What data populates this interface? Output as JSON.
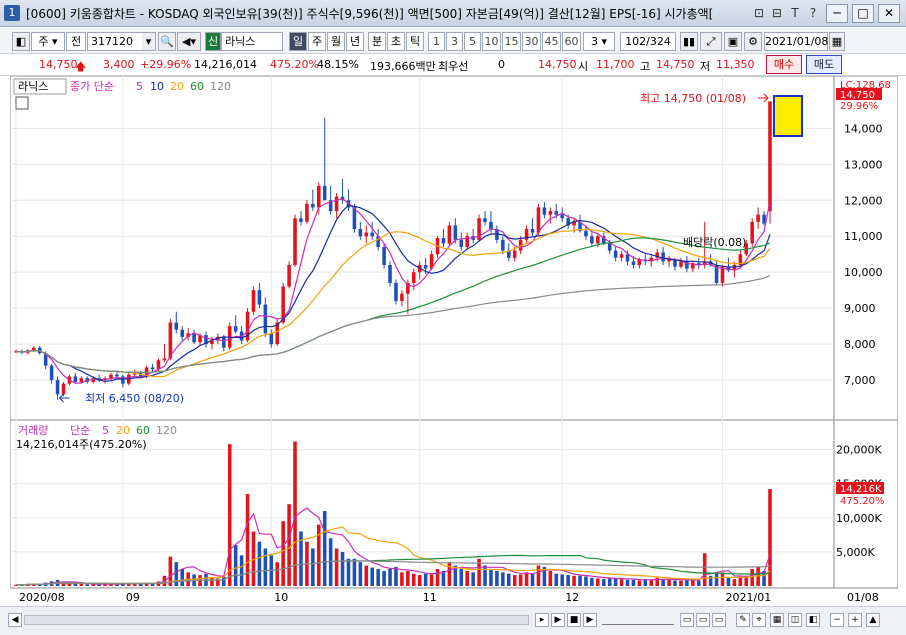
{
  "window": {
    "icon_label": "1",
    "title": "[0600] 키움종합차트 - KOSDAQ 외국인보유[39(천)] 주식수[9,596(천)] 액면[500] 자본금[49(억)] 결산[12월] EPS[-16] 시가총액[",
    "tools": [
      "⊡",
      "⊟",
      "T",
      "?"
    ],
    "minimize": "─",
    "maximize": "□",
    "close": "✕"
  },
  "toolbar": {
    "period_label": "주",
    "prev_label": "전",
    "code": "317120",
    "stock_badge": "신",
    "stock_name": "라닉스",
    "period_tabs": [
      "일",
      "주",
      "월",
      "년",
      "분",
      "초",
      "틱"
    ],
    "minute_options": [
      "1",
      "3",
      "5",
      "10",
      "15",
      "30",
      "45",
      "60"
    ],
    "minute_select": "3",
    "page_count": "102/324",
    "date": "2021/01/08"
  },
  "quote": {
    "price": "14,750",
    "change": "3,400",
    "change_pct": "+29.96%",
    "volume": "14,216,014",
    "vol_ratio": "475.20%",
    "turnover": "48.15%",
    "amount": "193,666백만",
    "priority_label": "최우선",
    "priority_value": "0",
    "last": "14,750",
    "open_label": "시",
    "open": "11,700",
    "high_label": "고",
    "high": "14,750",
    "low_label": "저",
    "low": "11,350",
    "buy_label": "매수",
    "sell_label": "매도"
  },
  "colors": {
    "up": "#e3121b",
    "down": "#1f4fb8",
    "ma5": "#c82fb6",
    "ma10": "#1a2a9e",
    "ma20": "#f0a30a",
    "ma60": "#1f8f3a",
    "ma120": "#8a8a8a"
  },
  "price_panel": {
    "legend_name": "라닉스",
    "legend_type": "종가 단순",
    "ma_periods": [
      "5",
      "10",
      "20",
      "60",
      "120"
    ],
    "right_top_label": "LC:128.68",
    "current_price_tag": "14,750",
    "current_pct_tag": "29.96%",
    "high_annotation": "최고 14,750 (01/08)",
    "low_annotation": "최저 6,450 (08/20)",
    "event_annotation": "배당락(0.08)",
    "y_ticks": [
      "14,000",
      "13,000",
      "12,000",
      "11,000",
      "10,000",
      "9,000",
      "8,000",
      "7,000"
    ]
  },
  "volume_panel": {
    "legend_name": "거래량",
    "legend_type": "단순",
    "ma_periods": [
      "5",
      "20",
      "60",
      "120"
    ],
    "current_value_label": "14,216,014주(475.20%)",
    "current_tag": "14,216K",
    "current_pct_tag": "475.20%",
    "y_ticks": [
      "20,000K",
      "15,000K",
      "10,000K",
      "5,000K"
    ]
  },
  "x_axis": {
    "labels": [
      "2020/08",
      "09",
      "10",
      "11",
      "12",
      "2021/01",
      "01/08"
    ]
  },
  "chart_data": {
    "type": "candlestick",
    "price_range": [
      6000,
      14900
    ],
    "volume_range": [
      0,
      22000
    ],
    "candles": [
      [
        7800,
        7850,
        7750,
        7800,
        180
      ],
      [
        7800,
        7850,
        7720,
        7760,
        200
      ],
      [
        7760,
        7860,
        7700,
        7830,
        260
      ],
      [
        7830,
        7950,
        7780,
        7900,
        300
      ],
      [
        7900,
        7950,
        7700,
        7750,
        350
      ],
      [
        7750,
        7800,
        7300,
        7400,
        500
      ],
      [
        7400,
        7450,
        6900,
        7000,
        700
      ],
      [
        7000,
        7100,
        6450,
        6600,
        900
      ],
      [
        6600,
        6950,
        6550,
        6900,
        500
      ],
      [
        6900,
        7150,
        6850,
        7100,
        450
      ],
      [
        7100,
        7200,
        6900,
        6950,
        350
      ],
      [
        6950,
        7100,
        6900,
        7050,
        300
      ],
      [
        7050,
        7100,
        6900,
        6950,
        260
      ],
      [
        6950,
        7100,
        6900,
        7050,
        280
      ],
      [
        7050,
        7150,
        6950,
        7000,
        250
      ],
      [
        7000,
        7100,
        6900,
        7050,
        260
      ],
      [
        7050,
        7200,
        7000,
        7150,
        300
      ],
      [
        7150,
        7250,
        7050,
        7100,
        280
      ],
      [
        7100,
        7150,
        6800,
        6900,
        350
      ],
      [
        6900,
        7200,
        6850,
        7150,
        420
      ],
      [
        7150,
        7300,
        7100,
        7200,
        380
      ],
      [
        7200,
        7250,
        7050,
        7100,
        300
      ],
      [
        7100,
        7400,
        7050,
        7350,
        450
      ],
      [
        7350,
        7450,
        7200,
        7300,
        350
      ],
      [
        7300,
        7600,
        7250,
        7550,
        650
      ],
      [
        7550,
        8000,
        7500,
        7600,
        1500
      ],
      [
        7600,
        8700,
        7550,
        8600,
        4300
      ],
      [
        8600,
        8900,
        8300,
        8400,
        3500
      ],
      [
        8400,
        8500,
        8100,
        8200,
        2500
      ],
      [
        8200,
        8450,
        8100,
        8300,
        2000
      ],
      [
        8300,
        8400,
        8000,
        8050,
        1700
      ],
      [
        8050,
        8300,
        7950,
        8250,
        1600
      ],
      [
        8250,
        8350,
        7900,
        8000,
        1800
      ],
      [
        8000,
        8200,
        7850,
        8100,
        1300
      ],
      [
        8100,
        8300,
        8000,
        8200,
        1100
      ],
      [
        8200,
        8250,
        7800,
        7900,
        1400
      ],
      [
        7900,
        8600,
        7850,
        8500,
        20800
      ],
      [
        8500,
        8800,
        8300,
        8350,
        6000
      ],
      [
        8350,
        8500,
        8000,
        8100,
        4500
      ],
      [
        8100,
        9000,
        8050,
        8900,
        13500
      ],
      [
        8900,
        9600,
        8800,
        9500,
        8000
      ],
      [
        9500,
        9700,
        9000,
        9100,
        6500
      ],
      [
        9100,
        9300,
        8200,
        8300,
        5500
      ],
      [
        8300,
        8400,
        7900,
        8000,
        4500
      ],
      [
        8000,
        8700,
        7950,
        8600,
        3500
      ],
      [
        8600,
        9700,
        8550,
        9600,
        9500
      ],
      [
        9600,
        10300,
        9550,
        10200,
        12000
      ],
      [
        10200,
        11600,
        10150,
        11500,
        21200
      ],
      [
        11500,
        11700,
        11300,
        11400,
        8000
      ],
      [
        11400,
        12000,
        11350,
        11900,
        6500
      ],
      [
        11900,
        12300,
        11700,
        11800,
        5500
      ],
      [
        11800,
        12500,
        11600,
        12400,
        9000
      ],
      [
        12400,
        14300,
        12000,
        12000,
        11000
      ],
      [
        12000,
        12400,
        11600,
        11700,
        7000
      ],
      [
        11700,
        12200,
        11500,
        12100,
        5500
      ],
      [
        12100,
        12600,
        11900,
        12000,
        5000
      ],
      [
        12000,
        12300,
        11700,
        11800,
        4000
      ],
      [
        11800,
        11900,
        11100,
        11200,
        4000
      ],
      [
        11200,
        11400,
        10900,
        11000,
        3500
      ],
      [
        11000,
        11300,
        10800,
        11100,
        3000
      ],
      [
        11100,
        11400,
        10900,
        11000,
        2700
      ],
      [
        11000,
        11200,
        10600,
        10700,
        2500
      ],
      [
        10700,
        10800,
        10100,
        10200,
        2200
      ],
      [
        10200,
        10300,
        9600,
        9700,
        2500
      ],
      [
        9700,
        9800,
        9100,
        9200,
        2800
      ],
      [
        9200,
        9500,
        9050,
        9400,
        2000
      ],
      [
        9400,
        9800,
        8850,
        9700,
        2200
      ],
      [
        9700,
        10100,
        9500,
        10000,
        1800
      ],
      [
        10000,
        10300,
        9800,
        10200,
        1600
      ],
      [
        10200,
        10400,
        9950,
        10100,
        1800
      ],
      [
        10100,
        10600,
        10050,
        10500,
        1700
      ],
      [
        10500,
        11000,
        10400,
        10950,
        2500
      ],
      [
        10950,
        11200,
        10700,
        10800,
        2200
      ],
      [
        10800,
        11400,
        10750,
        11300,
        3500
      ],
      [
        11300,
        11500,
        10800,
        10900,
        3000
      ],
      [
        10900,
        11100,
        10600,
        10700,
        2500
      ],
      [
        10700,
        11100,
        10650,
        11000,
        2200
      ],
      [
        11000,
        11200,
        10800,
        10900,
        2000
      ],
      [
        10900,
        11600,
        10850,
        11500,
        4000
      ],
      [
        11500,
        11700,
        11300,
        11400,
        3000
      ],
      [
        11400,
        11700,
        11100,
        11200,
        2500
      ],
      [
        11200,
        11300,
        10800,
        10900,
        2200
      ],
      [
        10900,
        11000,
        10500,
        10600,
        2000
      ],
      [
        10600,
        10800,
        10300,
        10400,
        1800
      ],
      [
        10400,
        10700,
        10300,
        10600,
        1600
      ],
      [
        10600,
        11000,
        10500,
        10900,
        1700
      ],
      [
        10900,
        11300,
        10800,
        11200,
        2000
      ],
      [
        11200,
        11500,
        11000,
        11100,
        1900
      ],
      [
        11100,
        11900,
        11000,
        11800,
        3000
      ],
      [
        11800,
        11950,
        11500,
        11600,
        2800
      ],
      [
        11600,
        11800,
        11350,
        11700,
        2200
      ],
      [
        11700,
        11900,
        11500,
        11600,
        1800
      ],
      [
        11600,
        11800,
        11400,
        11500,
        1700
      ],
      [
        11500,
        11600,
        11200,
        11300,
        1600
      ],
      [
        11300,
        11500,
        11100,
        11400,
        1500
      ],
      [
        11400,
        11600,
        11100,
        11150,
        1500
      ],
      [
        11150,
        11300,
        10900,
        11000,
        1400
      ],
      [
        11000,
        11100,
        10700,
        10800,
        1200
      ],
      [
        10800,
        11050,
        10700,
        11000,
        1100
      ],
      [
        11000,
        11100,
        10750,
        10800,
        1000
      ],
      [
        10800,
        10900,
        10500,
        10600,
        1200
      ],
      [
        10600,
        10700,
        10300,
        10400,
        1100
      ],
      [
        10400,
        10600,
        10300,
        10500,
        1000
      ],
      [
        10500,
        10600,
        10200,
        10300,
        900
      ],
      [
        10300,
        10450,
        10100,
        10200,
        900
      ],
      [
        10200,
        10400,
        10100,
        10350,
        800
      ],
      [
        10350,
        10500,
        10200,
        10300,
        1000
      ],
      [
        10300,
        10500,
        10150,
        10400,
        900
      ],
      [
        10400,
        10650,
        10300,
        10550,
        1200
      ],
      [
        10550,
        10700,
        10200,
        10300,
        1000
      ],
      [
        10300,
        10450,
        10150,
        10350,
        900
      ],
      [
        10350,
        10400,
        10050,
        10150,
        800
      ],
      [
        10150,
        10400,
        10100,
        10300,
        800
      ],
      [
        10300,
        10450,
        10000,
        10100,
        1000
      ],
      [
        10100,
        10300,
        10000,
        10250,
        900
      ],
      [
        10250,
        10400,
        10100,
        10200,
        800
      ],
      [
        10200,
        11400,
        10100,
        10300,
        4800
      ],
      [
        10300,
        10500,
        10150,
        10200,
        1500
      ],
      [
        10200,
        10300,
        9650,
        9700,
        1800
      ],
      [
        9700,
        10200,
        9600,
        10150,
        2000
      ],
      [
        10150,
        10400,
        10000,
        10050,
        1200
      ],
      [
        10050,
        10300,
        9850,
        10200,
        1000
      ],
      [
        10200,
        10600,
        10100,
        10500,
        1300
      ],
      [
        10500,
        10900,
        10450,
        10800,
        1500
      ],
      [
        10800,
        11500,
        10700,
        11400,
        2500
      ],
      [
        11400,
        11800,
        11200,
        11600,
        2800
      ],
      [
        11600,
        11700,
        11300,
        11350,
        2200
      ],
      [
        11700,
        14750,
        11350,
        14750,
        14216
      ]
    ]
  }
}
